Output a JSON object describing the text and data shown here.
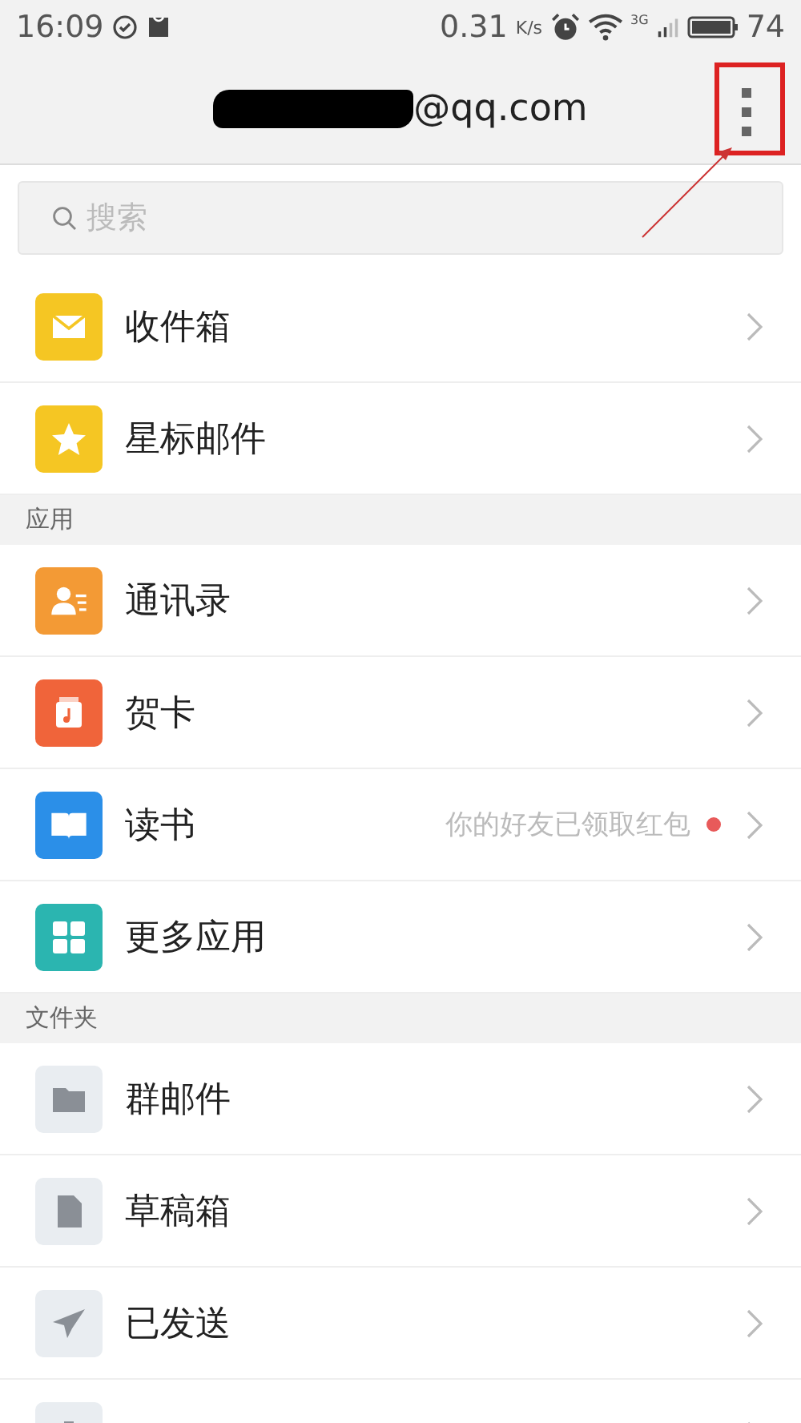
{
  "status_bar": {
    "time": "16:09",
    "speed": "0.31",
    "speed_unit": "K/s",
    "network": "3G",
    "battery": "74"
  },
  "header": {
    "account": "@qq.com"
  },
  "search": {
    "placeholder": "搜索"
  },
  "sections": [
    {
      "items": [
        {
          "kind": "mail",
          "label": "收件箱",
          "color": "#f5c623"
        },
        {
          "kind": "star",
          "label": "星标邮件",
          "color": "#f5c623"
        }
      ]
    },
    {
      "title": "应用",
      "items": [
        {
          "kind": "contact",
          "label": "通讯录",
          "color": "#f39a35"
        },
        {
          "kind": "card",
          "label": "贺卡",
          "color": "#f0643a"
        },
        {
          "kind": "book",
          "label": "读书",
          "color": "#2b8fe8",
          "note": "你的好友已领取红包",
          "dot": true
        },
        {
          "kind": "grid",
          "label": "更多应用",
          "color": "#2bb5b0"
        }
      ]
    },
    {
      "title": "文件夹",
      "items": [
        {
          "kind": "folder",
          "label": "群邮件",
          "color": "#e9edf1"
        },
        {
          "kind": "doc",
          "label": "草稿箱",
          "color": "#e9edf1"
        },
        {
          "kind": "send",
          "label": "已发送",
          "color": "#e9edf1"
        },
        {
          "kind": "trash",
          "color": "#e9edf1"
        }
      ]
    }
  ]
}
